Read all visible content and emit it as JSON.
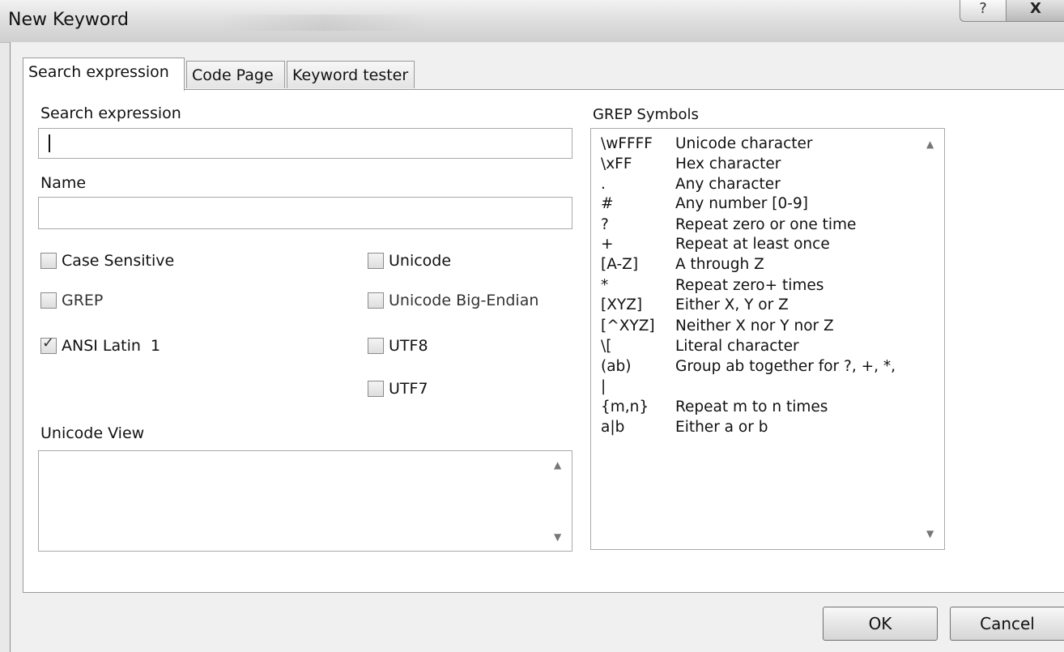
{
  "window": {
    "title": "New Keyword",
    "help_label": "?",
    "close_label": "X"
  },
  "tabs": [
    {
      "label": "Search expression",
      "active": true
    },
    {
      "label": "Code Page",
      "active": false
    },
    {
      "label": "Keyword tester",
      "active": false
    }
  ],
  "form": {
    "search_label": "Search expression",
    "search_value": "",
    "name_label": "Name",
    "name_value": "",
    "unicode_view_label": "Unicode View",
    "unicode_view_value": ""
  },
  "options": {
    "case_sensitive": {
      "label": "Case Sensitive",
      "checked": false
    },
    "grep": {
      "label": "GREP",
      "checked": false
    },
    "ansi_latin": {
      "label": "ANSI Latin  1",
      "checked": true
    },
    "unicode": {
      "label": "Unicode",
      "checked": false
    },
    "unicode_big_endian": {
      "label": "Unicode Big-Endian",
      "checked": false
    },
    "utf8": {
      "label": "UTF8",
      "checked": false
    },
    "utf7": {
      "label": "UTF7",
      "checked": false
    }
  },
  "grep": {
    "label": "GREP Symbols",
    "symbols": [
      {
        "symbol": "\\wFFFF",
        "description": "Unicode character"
      },
      {
        "symbol": "\\xFF",
        "description": "Hex character"
      },
      {
        "symbol": ".",
        "description": "Any character"
      },
      {
        "symbol": "#",
        "description": "Any number [0-9]"
      },
      {
        "symbol": "?",
        "description": "Repeat zero or one time"
      },
      {
        "symbol": "+",
        "description": "Repeat at least once"
      },
      {
        "symbol": "[A-Z]",
        "description": "A through Z"
      },
      {
        "symbol": "*",
        "description": "Repeat zero+ times"
      },
      {
        "symbol": "[XYZ]",
        "description": "Either X, Y or Z"
      },
      {
        "symbol": "[^XYZ]",
        "description": "Neither X nor Y nor Z"
      },
      {
        "symbol": "\\[",
        "description": "Literal character"
      },
      {
        "symbol": "(ab)",
        "description": "Group ab together for ?, +, *,"
      },
      {
        "symbol": "|",
        "description": ""
      },
      {
        "symbol": "{m,n}",
        "description": "Repeat m to n times"
      },
      {
        "symbol": "a|b",
        "description": "Either a or b"
      }
    ]
  },
  "buttons": {
    "ok": "OK",
    "cancel": "Cancel"
  },
  "icons": {
    "scroll_up": "scroll-up-arrow-icon",
    "scroll_down": "scroll-down-arrow-icon",
    "checkmark": "checkmark-icon"
  }
}
